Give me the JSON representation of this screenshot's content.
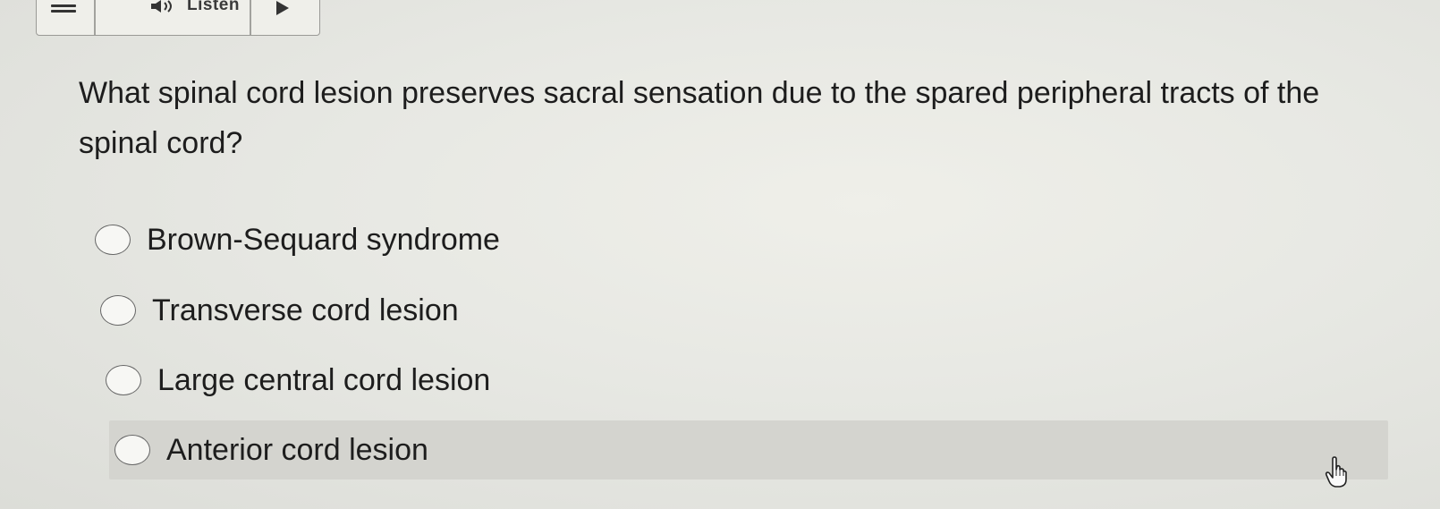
{
  "toolbar": {
    "menu_icon": "hamburger-menu-icon",
    "speaker_icon": "speaker-icon",
    "listen_label": "Listen",
    "play_icon": "play-icon"
  },
  "question": {
    "text": "What spinal cord lesion preserves sacral sensation due to the spared peripheral tracts of the spinal cord?"
  },
  "options": [
    {
      "label": "Brown-Sequard syndrome",
      "selected": false
    },
    {
      "label": "Transverse cord lesion",
      "selected": false
    },
    {
      "label": "Large central cord lesion",
      "selected": false
    },
    {
      "label": "Anterior cord lesion",
      "selected": false,
      "hovered": true
    }
  ],
  "cursor": "hand-pointer-icon"
}
